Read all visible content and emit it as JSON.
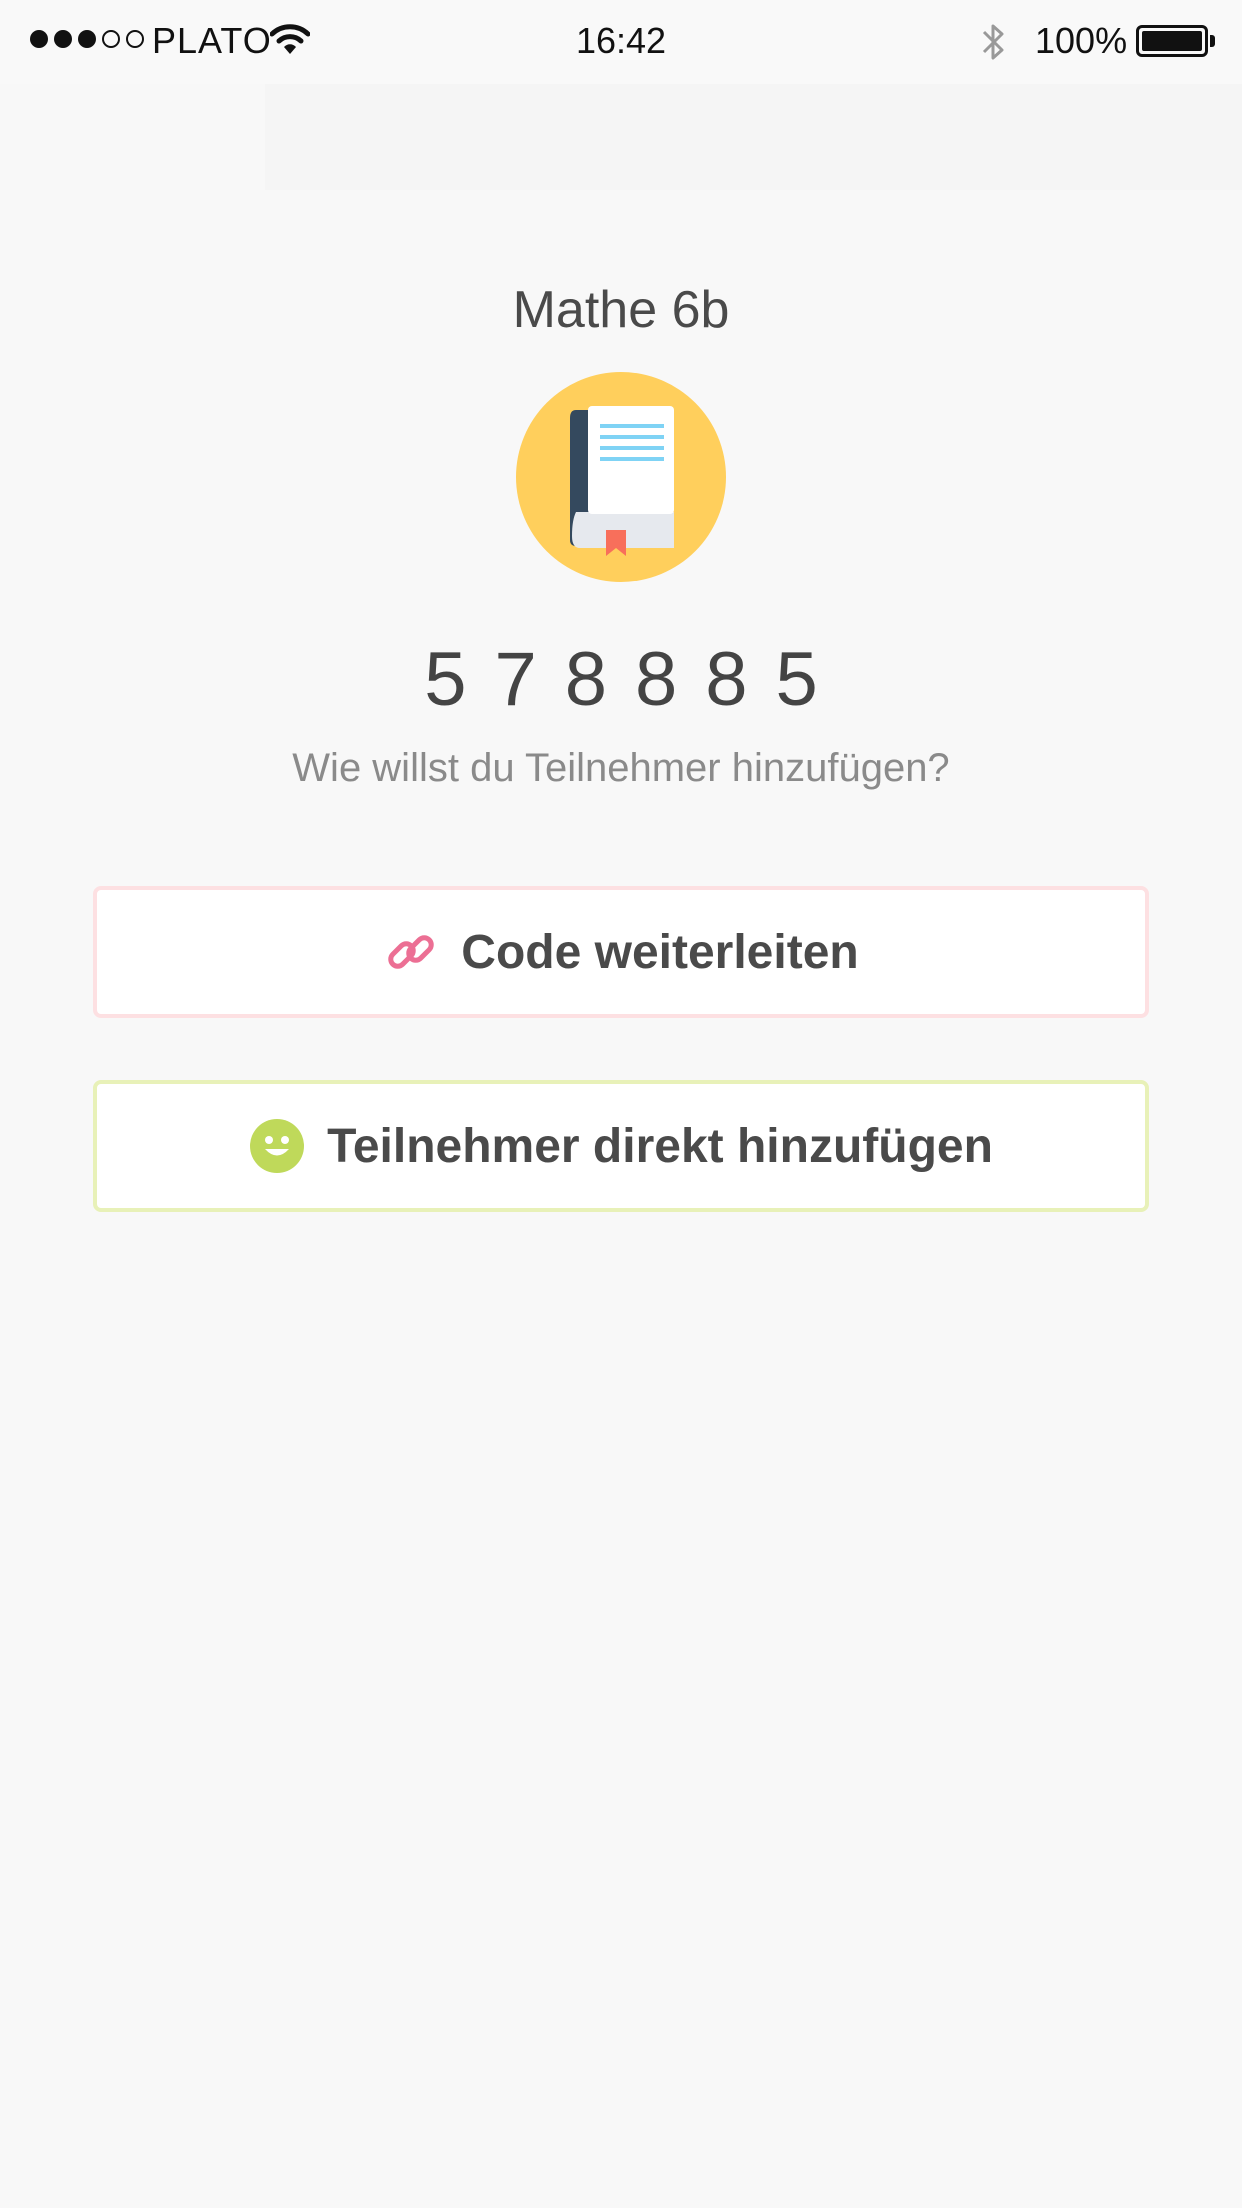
{
  "status_bar": {
    "signal_bars_filled": 3,
    "signal_bars_total": 5,
    "carrier": "PLATO",
    "time": "16:42",
    "battery_percent": "100%"
  },
  "group": {
    "name": "Mathe 6b",
    "icon": "book-icon",
    "code": "578885"
  },
  "prompt": "Wie willst du Teilnehmer hinzufügen?",
  "actions": {
    "share_code": {
      "label": "Code weiterleiten",
      "icon": "link-icon",
      "accent": "#ec6f94"
    },
    "add_direct": {
      "label": "Teilnehmer direkt hinzufügen",
      "icon": "smiley-icon",
      "accent": "#bfd95a"
    }
  },
  "colors": {
    "background": "#f8f8f8",
    "icon_circle": "#ffcf5c",
    "share_border": "#fde0e2",
    "add_border": "#e8f1b8"
  }
}
